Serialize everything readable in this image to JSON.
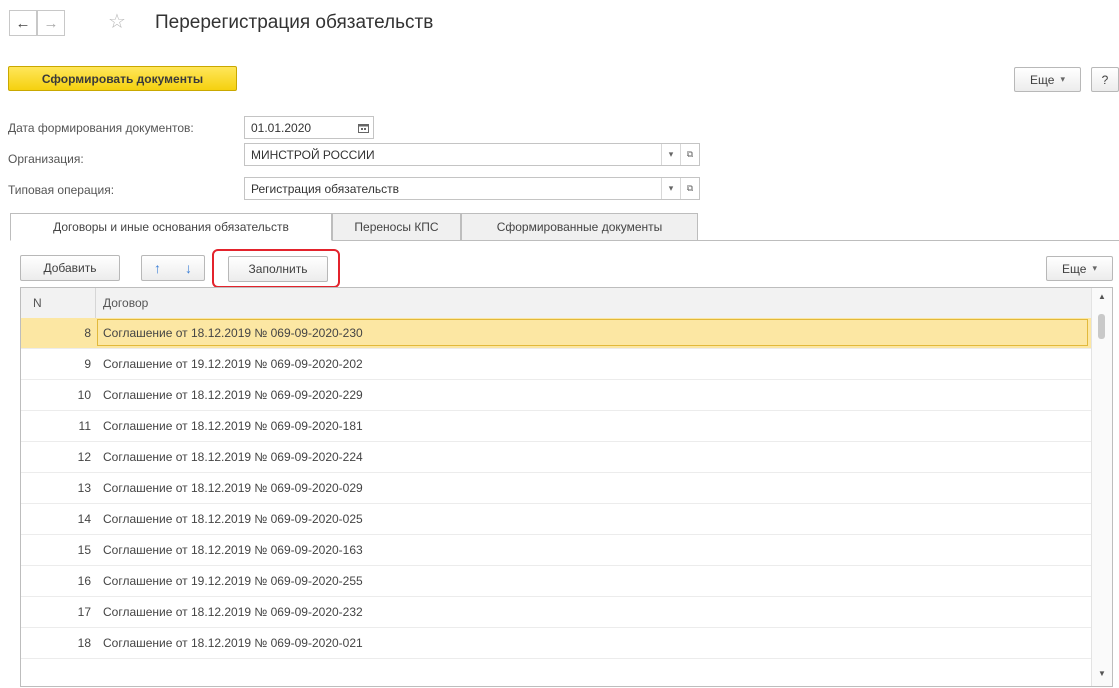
{
  "header": {
    "title": "Перерегистрация обязательств",
    "back_icon": "←",
    "forward_icon": "→",
    "star_icon": "☆"
  },
  "toolbar": {
    "generate_label": "Сформировать документы",
    "more_label": "Еще",
    "help_label": "?"
  },
  "form": {
    "date_label": "Дата формирования документов:",
    "date_value": "01.01.2020",
    "org_label": "Организация:",
    "org_value": "МИНСТРОЙ РОССИИ",
    "operation_label": "Типовая операция:",
    "operation_value": "Регистрация обязательств"
  },
  "tabs": [
    {
      "label": "Договоры и иные основания обязательств"
    },
    {
      "label": "Переносы КПС"
    },
    {
      "label": "Сформированные документы"
    }
  ],
  "table_toolbar": {
    "add_label": "Добавить",
    "up_icon": "🡅",
    "down_icon": "🡇",
    "fill_label": "Заполнить",
    "more_label": "Еще"
  },
  "table": {
    "columns": [
      "N",
      "Договор"
    ],
    "rows": [
      {
        "n": "8",
        "doc": "Соглашение от 18.12.2019 № 069-09-2020-230"
      },
      {
        "n": "9",
        "doc": "Соглашение от 19.12.2019 № 069-09-2020-202"
      },
      {
        "n": "10",
        "doc": "Соглашение от 18.12.2019 № 069-09-2020-229"
      },
      {
        "n": "11",
        "doc": "Соглашение от 18.12.2019 № 069-09-2020-181"
      },
      {
        "n": "12",
        "doc": "Соглашение от 18.12.2019 № 069-09-2020-224"
      },
      {
        "n": "13",
        "doc": "Соглашение от 18.12.2019 № 069-09-2020-029"
      },
      {
        "n": "14",
        "doc": "Соглашение от 18.12.2019 № 069-09-2020-025"
      },
      {
        "n": "15",
        "doc": "Соглашение от 18.12.2019 № 069-09-2020-163"
      },
      {
        "n": "16",
        "doc": "Соглашение от 19.12.2019 № 069-09-2020-255"
      },
      {
        "n": "17",
        "doc": "Соглашение от 18.12.2019 № 069-09-2020-232"
      },
      {
        "n": "18",
        "doc": "Соглашение от 18.12.2019 № 069-09-2020-021"
      }
    ],
    "selected_row": 0
  },
  "colors": {
    "accent_yellow": "#f5d10f",
    "selection": "#fce7a3",
    "highlight_red": "#e3232c",
    "arrow_blue": "#3c7fd6"
  }
}
